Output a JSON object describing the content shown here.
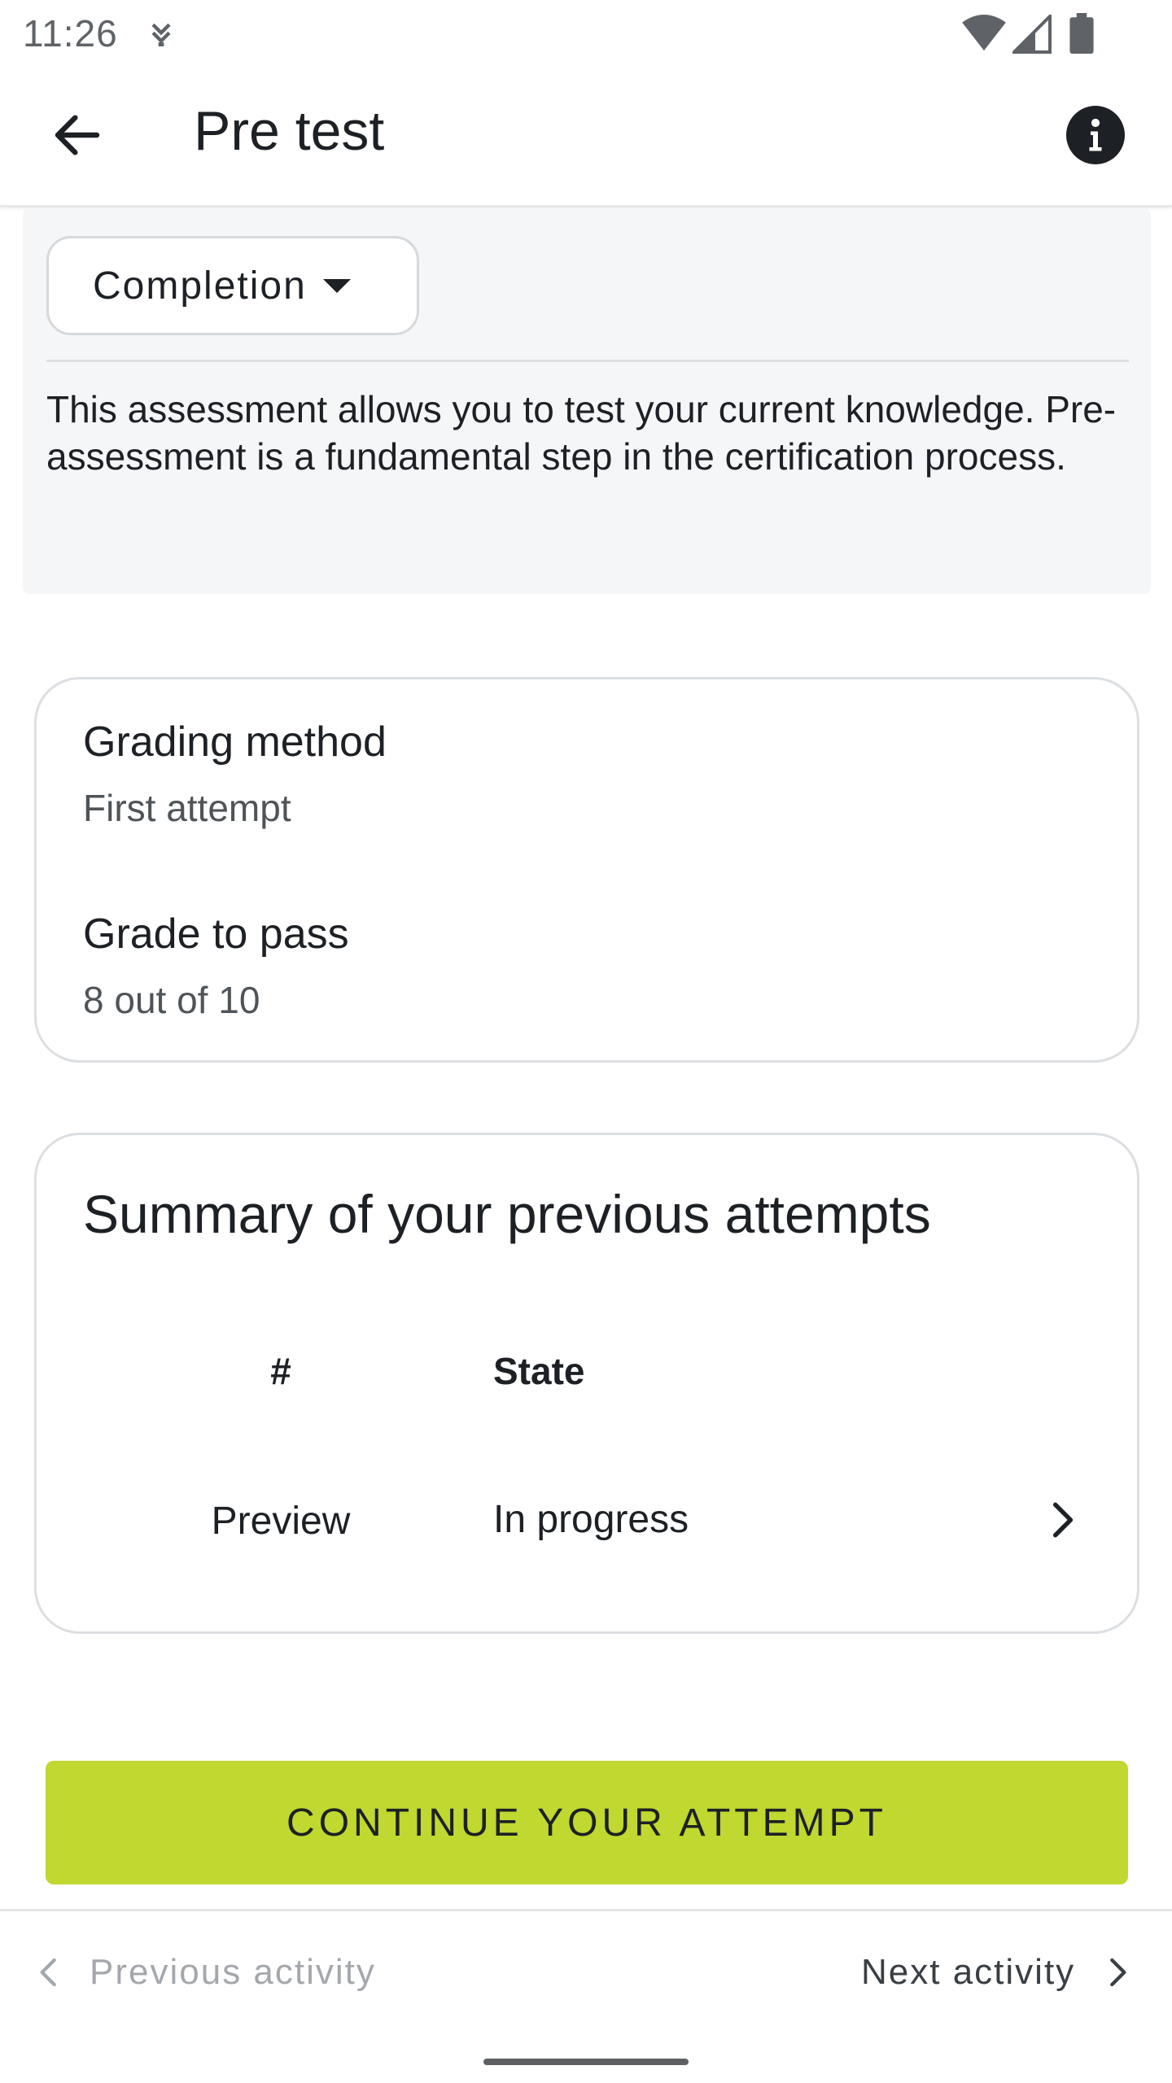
{
  "status_bar": {
    "time": "11:26"
  },
  "app_bar": {
    "title": "Pre test",
    "back_icon": "arrow-left-icon",
    "info_icon": "info-circle-icon"
  },
  "description": {
    "completion_label": "Completion",
    "text": "This assessment allows you to test your current knowledge. Pre-assessment is a fundamental step in the certification process."
  },
  "grading": {
    "method_label": "Grading method",
    "method_value": "First attempt",
    "pass_label": "Grade to pass",
    "pass_value": "8 out of 10"
  },
  "attempts": {
    "title": "Summary of your previous attempts",
    "columns": [
      "#",
      "State"
    ],
    "rows": [
      {
        "num": "Preview",
        "state": "In progress"
      }
    ]
  },
  "continue_button": {
    "label": "CONTINUE YOUR ATTEMPT"
  },
  "bottom_nav": {
    "prev_label": "Previous activity",
    "next_label": "Next activity"
  },
  "colors": {
    "accent": "#c0d82f",
    "text": "#1d2125",
    "panel_bg": "#f5f6f8"
  }
}
